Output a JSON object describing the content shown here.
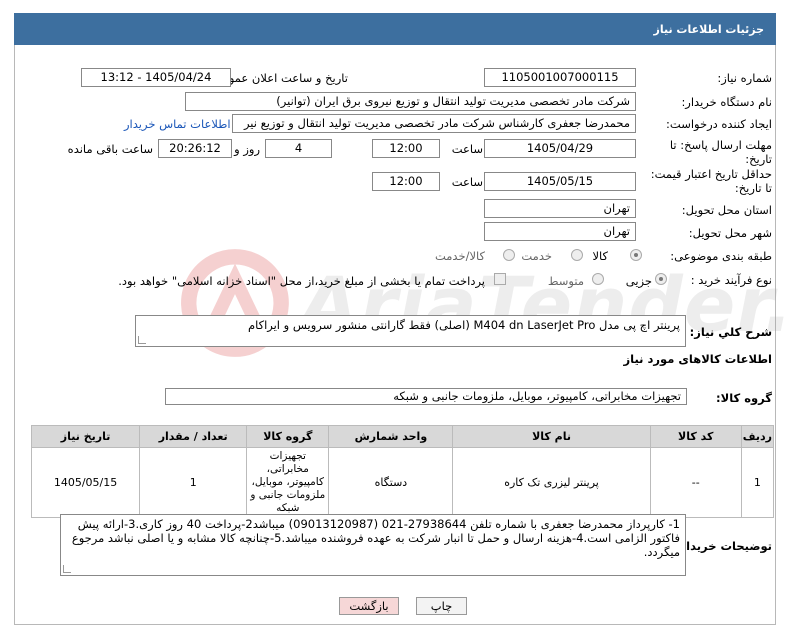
{
  "header": {
    "title": "جزئیات اطلاعات نیاز"
  },
  "form": {
    "need_number_label": "شماره نیاز:",
    "need_number": "1105001007000115",
    "announce_label": "تاریخ و ساعت اعلان عمومی:",
    "announce_value": "1405/04/24 - 13:12",
    "buyer_org_label": "نام دستگاه خریدار:",
    "buyer_org": "شرکت مادر تخصصی مدیریت تولید  انتقال و توزیع نیروی برق ایران (توانیر)",
    "requester_label": "ایجاد کننده درخواست:",
    "requester": "محمدرضا جعفری کارشناس شرکت مادر تخصصی مدیریت تولید  انتقال و توزیع نیر",
    "contact_link": "اطلاعات تماس خریدار",
    "deadline_label_1": "مهلت ارسال پاسخ: تا",
    "deadline_label_2": "تاریخ:",
    "deadline_date": "1405/04/29",
    "time_label": "ساعت",
    "deadline_time": "12:00",
    "days_value": "4",
    "days_label": "روز و",
    "remaining_time": "20:26:12",
    "remaining_label": "ساعت باقی مانده",
    "validity_label_1": "حداقل تاریخ اعتبار قیمت:",
    "validity_label_2": "تا تاریخ:",
    "validity_date": "1405/05/15",
    "validity_time": "12:00",
    "province_label": "استان محل تحویل:",
    "province": "تهران",
    "city_label": "شهر محل تحویل:",
    "city": "تهران",
    "category_label": "طبقه بندی موضوعی:",
    "category_options": [
      "کالا",
      "خدمت",
      "کالا/خدمت"
    ],
    "process_label": "نوع فرآیند خرید :",
    "process_options": [
      "جزیی",
      "متوسط"
    ],
    "payment_note": "پرداخت تمام یا بخشی از مبلغ خرید،از محل \"اسناد خزانه اسلامی\" خواهد بود."
  },
  "summary": {
    "label": "شرح کلي نياز:",
    "text": "پرینتر اچ پی مدل M404 dn LaserJet Pro (اصلی) فقط گارانتی منشور سرویس و ایراکام"
  },
  "goods": {
    "section_title": "اطلاعات کالاهای مورد نیاز",
    "group_label": "گروه کالا:",
    "group_value": "تجهیزات مخابراتی، کامپیوتر، موبایل، ملزومات جانبی و شبکه",
    "columns": [
      "ردیف",
      "کد کالا",
      "نام کالا",
      "واحد شمارش",
      "گروه کالا",
      "تعداد / مقدار",
      "تاریخ نیاز"
    ],
    "rows": [
      [
        "1",
        "--",
        "پرینتر لیزری تک کاره",
        "دستگاه",
        "تجهیزات مخابراتی، کامپیوتر، موبایل، ملزومات جانبی و شبکه",
        "1",
        "1405/05/15"
      ]
    ]
  },
  "notes": {
    "label": "توضیحات خریدار:",
    "text": "1- کارپرداز محمدرضا جعفری با شماره تلفن 27938644-021  (09013120987) میباشد2-پرداخت 40 روز کاری.3-ارائه پیش فاکتور الزامی است.4-هزینه ارسال و حمل تا انبار شرکت به عهده فروشنده میباشد.5-چنانچه کالا مشابه و یا اصلی نباشد مرجوع میگردد."
  },
  "buttons": {
    "print": "چاپ",
    "back": "بازگشت"
  },
  "watermark": "AriaTender.net",
  "colors": {
    "header_bg": "#3d6f9f",
    "link": "#1a56b8",
    "back_btn_bg": "#f6d7d7"
  }
}
